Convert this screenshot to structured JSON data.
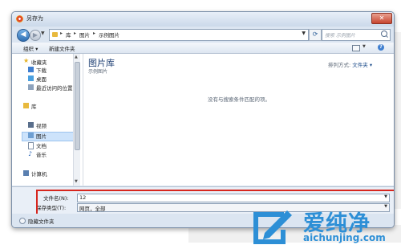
{
  "dialog": {
    "title": "另存为",
    "close_label": "✕"
  },
  "address": {
    "crumbs": [
      "库",
      "图片",
      "示例图片"
    ],
    "search_placeholder": "搜索 示例图片"
  },
  "toolbar": {
    "organize_label": "组织 ▾",
    "new_folder_label": "新建文件夹"
  },
  "nav": {
    "favorites": "收藏夹",
    "downloads": "下载",
    "desktop": "桌面",
    "recent": "最近访问的位置",
    "libraries": "库",
    "videos": "视频",
    "pictures": "图片",
    "documents": "文档",
    "music": "音乐",
    "computer": "计算机"
  },
  "content": {
    "library_title": "图片库",
    "library_subtitle": "示例图片",
    "arrange_label": "排列方式:",
    "arrange_value": "文件夹 ▾",
    "empty_message": "没有与搜索条件匹配的项。"
  },
  "form": {
    "filename_label": "文件名(N):",
    "filename_value": "12",
    "filetype_label": "保存类型(T):",
    "filetype_value": "网页，全部"
  },
  "footer": {
    "hide_folders_label": "隐藏文件夹"
  },
  "watermark": {
    "brand_name": "爱纯净",
    "brand_url": "aichunjing.com"
  },
  "colors": {
    "highlight_border": "#d7261e",
    "brand": "#2d8fd6",
    "library_title": "#1e3f73"
  }
}
